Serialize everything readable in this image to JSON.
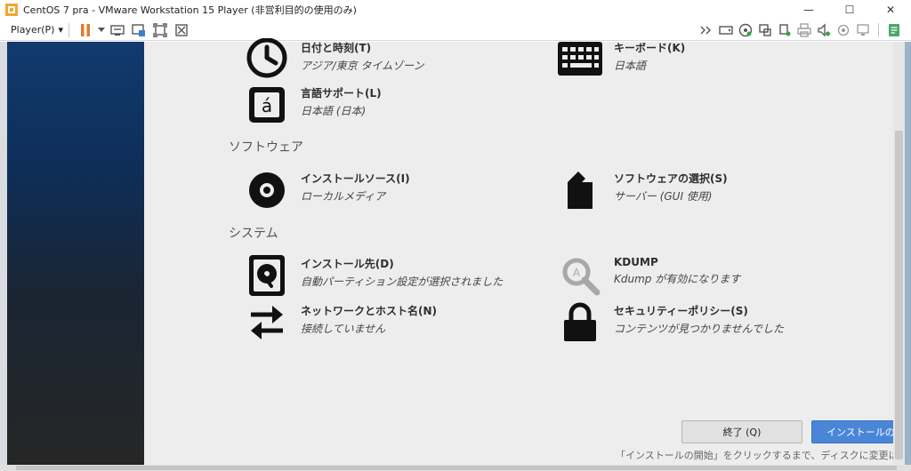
{
  "window": {
    "title": "CentOS 7 pra - VMware Workstation 15 Player (非営利目的の使用のみ)",
    "minimize": "—",
    "maximize": "☐",
    "close": "✕"
  },
  "toolbar": {
    "player_menu": "Player(P)",
    "dropdown_glyph": "▾"
  },
  "sections": {
    "software": "ソフトウェア",
    "system": "システム"
  },
  "spokes": {
    "datetime": {
      "title": "日付と時刻(T)",
      "status": "アジア/東京 タイムゾーン",
      "icon": "clock-icon"
    },
    "keyboard": {
      "title": "キーボード(K)",
      "status": "日本語",
      "icon": "keyboard-icon"
    },
    "language": {
      "title": "言語サポート(L)",
      "status": "日本語 (日本)",
      "icon": "language-icon"
    },
    "source": {
      "title": "インストールソース(I)",
      "status": "ローカルメディア",
      "icon": "disc-icon"
    },
    "software": {
      "title": "ソフトウェアの選択(S)",
      "status": "サーバー (GUI 使用)",
      "icon": "package-icon"
    },
    "destination": {
      "title": "インストール先(D)",
      "status": "自動パーティション設定が選択されました",
      "icon": "harddisk-icon"
    },
    "kdump": {
      "title": "KDUMP",
      "status": "Kdump が有効になります",
      "icon": "search-icon"
    },
    "network": {
      "title": "ネットワークとホスト名(N)",
      "status": "接続していません",
      "icon": "network-arrows-icon"
    },
    "security": {
      "title": "セキュリティーポリシー(S)",
      "status": "コンテンツが見つかりませんでした",
      "icon": "lock-icon"
    }
  },
  "buttons": {
    "quit": "終了 (Q)",
    "begin_install": "インストールの開始(B)"
  },
  "footer_note": "「インストールの開始」をクリックするまで、ディスクに変更は行われません。",
  "colors": {
    "accent": "#4a86d8",
    "background": "#ededed"
  }
}
